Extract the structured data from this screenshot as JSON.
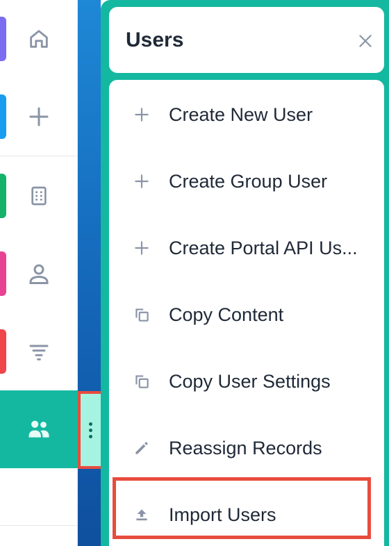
{
  "sidebar": {
    "items": [
      {
        "icon": "home-icon",
        "accent": "#7c6cf2"
      },
      {
        "icon": "plus-icon",
        "accent": "#1a9cf0"
      },
      {
        "icon": "building-icon",
        "accent": "#17b26a"
      },
      {
        "icon": "user-icon",
        "accent": "#e84393"
      },
      {
        "icon": "filter-icon",
        "accent": "#f0454a"
      },
      {
        "icon": "users-icon",
        "accent": "#14b8a0",
        "active": true
      }
    ]
  },
  "drag_handle": {
    "icon": "vertical-dots-icon"
  },
  "panel": {
    "title": "Users",
    "close_icon": "close-icon",
    "menu": [
      {
        "label": "Create New User",
        "icon": "plus-icon"
      },
      {
        "label": "Create Group User",
        "icon": "plus-icon"
      },
      {
        "label": "Create Portal API Us...",
        "icon": "plus-icon"
      },
      {
        "label": "Copy Content",
        "icon": "copy-icon"
      },
      {
        "label": "Copy User Settings",
        "icon": "copy-icon"
      },
      {
        "label": "Reassign Records",
        "icon": "pencil-icon"
      },
      {
        "label": "Import Users",
        "icon": "upload-icon"
      }
    ]
  },
  "colors": {
    "accent_teal": "#14b8a0",
    "highlight_red": "#e84c3d",
    "icon_gray": "#8a94a6",
    "text_dark": "#1f2937"
  }
}
